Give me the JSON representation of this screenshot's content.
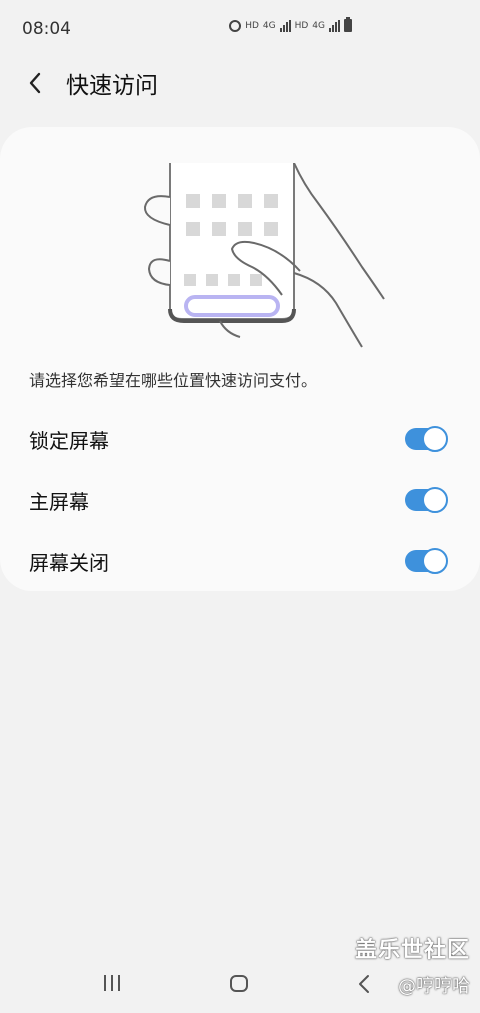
{
  "status_bar": {
    "time": "08:04",
    "net_labels": [
      "HD",
      "4G",
      "HD",
      "4G"
    ]
  },
  "header": {
    "title": "快速访问"
  },
  "card": {
    "description": "请选择您希望在哪些位置快速访问支付。",
    "options": [
      {
        "label": "锁定屏幕",
        "enabled": true
      },
      {
        "label": "主屏幕",
        "enabled": true
      },
      {
        "label": "屏幕关闭",
        "enabled": true
      }
    ]
  },
  "watermark": {
    "title": "盖乐世社区",
    "user": "@哼哼哈"
  },
  "colors": {
    "accent": "#3e91dc",
    "background": "#f2f2f2",
    "card": "#fafafa"
  },
  "icons": {
    "back": "back-chevron-icon",
    "recent_apps": "recent-apps-icon",
    "home": "home-icon",
    "nav_back": "nav-back-icon"
  }
}
